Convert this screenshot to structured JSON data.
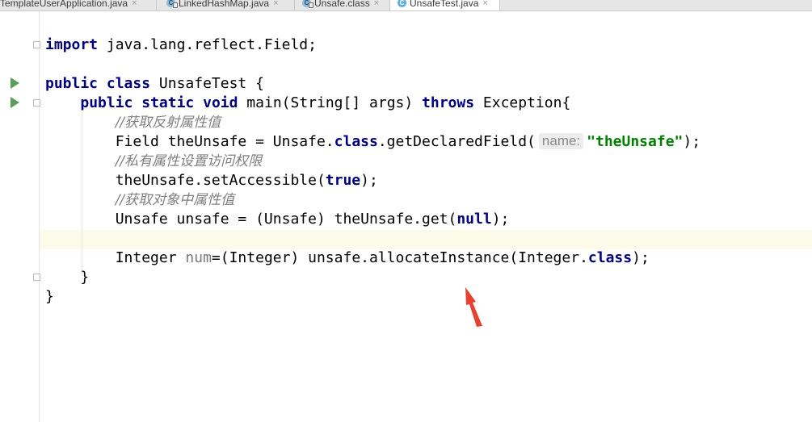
{
  "tabs": [
    {
      "label": "TemplateUserApplication.java",
      "icon": "none",
      "active": false
    },
    {
      "label": "LinkedHashMap.java",
      "icon": "class-library-icon",
      "active": false
    },
    {
      "label": "Unsafe.class",
      "icon": "class-library-icon",
      "active": false
    },
    {
      "label": "UnsafeTest.java",
      "icon": "class-icon",
      "active": true
    }
  ],
  "icon_letter": "C",
  "close_glyph": "×",
  "code": {
    "l1": {
      "kw": "import",
      "rest": " java.lang.reflect.Field;"
    },
    "l2": {
      "kw1": "public",
      "kw2": "class",
      "rest": " UnsafeTest {"
    },
    "l3": {
      "indent": "    ",
      "kw1": "public",
      "kw2": "static",
      "kw3": "void",
      "mid": " main(String[] args) ",
      "kw4": "throws",
      "rest": " Exception{"
    },
    "l4": {
      "indent": "        ",
      "comment": "//获取反射属性值"
    },
    "l5": {
      "indent": "        ",
      "pre": "Field theUnsafe = Unsafe.",
      "kw": "class",
      "mid": ".getDeclaredField(",
      "hint": "name:",
      "str": "\"theUnsafe\"",
      "rest": ");"
    },
    "l6": {
      "indent": "        ",
      "comment": "//私有属性设置访问权限"
    },
    "l7": {
      "indent": "        ",
      "pre": "theUnsafe.setAccessible(",
      "kw": "true",
      "rest": ");"
    },
    "l8": {
      "indent": "        ",
      "comment": "//获取对象中属性值"
    },
    "l9": {
      "indent": "        ",
      "pre": "Unsafe unsafe = (Unsafe) theUnsafe.get(",
      "kw": "null",
      "rest": ");"
    },
    "l11": {
      "indent": "        ",
      "pre": "Integer ",
      "var": "num",
      "mid": "=(Integer) unsafe.allocateInstance(Integer.",
      "kw": "class",
      "rest": ");"
    },
    "l12": {
      "indent": "    ",
      "text": "}"
    },
    "l13": {
      "text": "}"
    }
  },
  "colors": {
    "keyword": "#000080",
    "string": "#008000",
    "comment": "#808080",
    "run": "#5aa05a",
    "arrow": "#e8402e"
  }
}
